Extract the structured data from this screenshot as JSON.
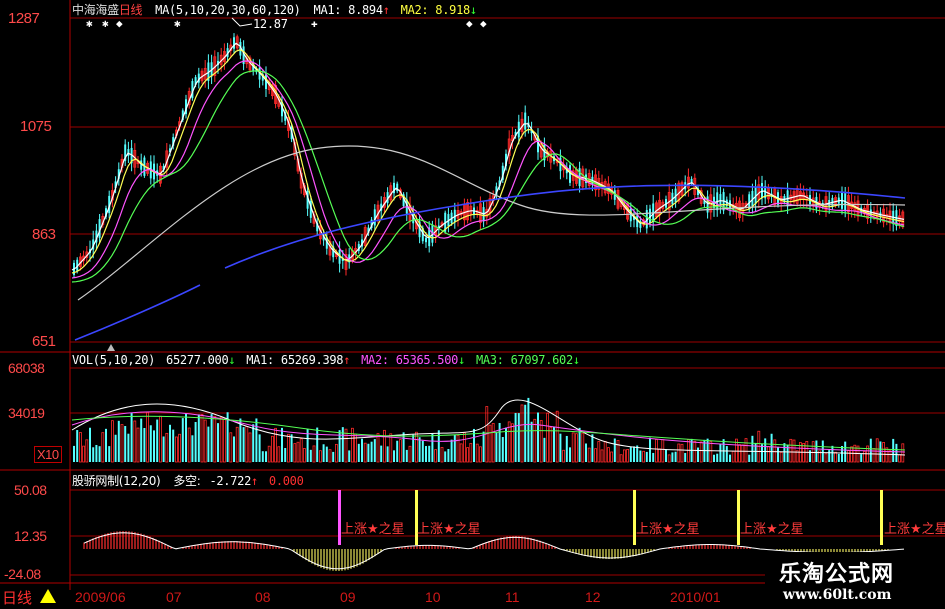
{
  "stock": {
    "name": "中海海盛",
    "period": "日线"
  },
  "main_panel": {
    "ma_label": "MA(5,10,20,30,60,120)",
    "ma1_label": "MA1:",
    "ma1_value": "8.894",
    "ma1_arrow": "↑",
    "ma2_label": "MA2:",
    "ma2_value": "8.918",
    "ma2_arrow": "↓",
    "peak_label": "12.87",
    "y_labels": [
      "1287",
      "1075",
      "863",
      "651"
    ]
  },
  "volume_panel": {
    "label": "VOL(5,10,20)",
    "value": "65277.000",
    "value_arrow": "↓",
    "ma1_label": "MA1:",
    "ma1_value": "65269.398",
    "ma1_arrow": "↑",
    "ma2_label": "MA2:",
    "ma2_value": "65365.500",
    "ma2_arrow": "↓",
    "ma3_label": "MA3:",
    "ma3_value": "67097.602",
    "ma3_arrow": "↓",
    "y_labels": [
      "68038",
      "34019"
    ],
    "unit": "X10"
  },
  "indicator_panel": {
    "label": "股骄网制(12,20)",
    "dk_label": "多空:",
    "dk_value": "-2.722",
    "dk_arrow": "↑",
    "zero_value": "0.000",
    "y_labels": [
      "50.08",
      "12.35",
      "-24.08"
    ],
    "signal_text": "上涨★之星"
  },
  "date_axis": [
    "2009/06",
    "07",
    "08",
    "09",
    "10",
    "11",
    "12",
    "2010/01"
  ],
  "footer": {
    "period_label": "日线"
  },
  "watermark": {
    "title": "乐淘公式网",
    "url": "www.60lt.com"
  },
  "colors": {
    "background": "#000000",
    "grid": "#9b0000",
    "up_candle": "#ff2a2a",
    "down_candle": "#55ffff",
    "ma5": "#ffffff",
    "ma10": "#ffff55",
    "ma20": "#ff55ff",
    "ma30": "#55ff55",
    "ma60": "#cccccc",
    "ma120": "#3b46ff"
  }
}
